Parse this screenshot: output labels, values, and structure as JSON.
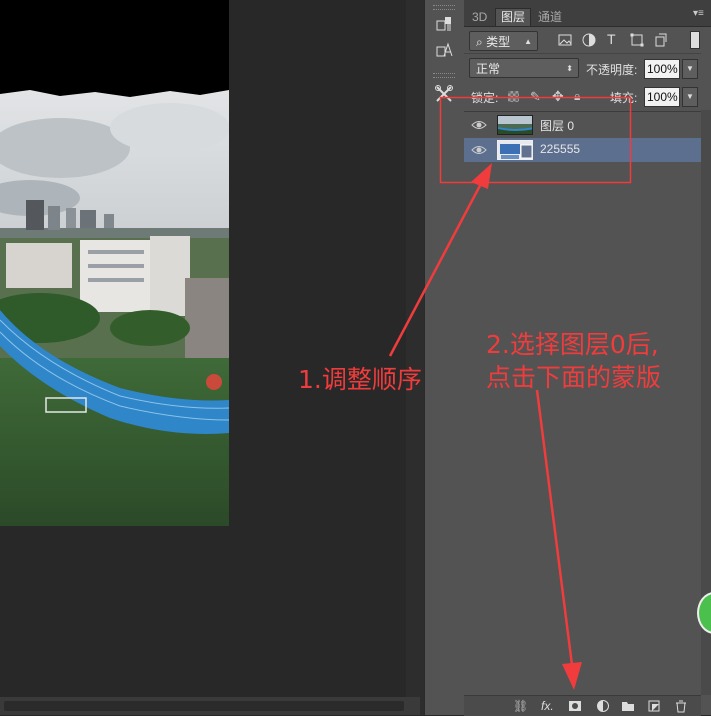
{
  "panel": {
    "tabs": [
      {
        "label": "3D"
      },
      {
        "label": "图层"
      },
      {
        "label": "通道"
      }
    ],
    "filter": {
      "label": "类型"
    },
    "blend_mode": {
      "value": "正常"
    },
    "opacity": {
      "label": "不透明度:",
      "value": "100%"
    },
    "lock": {
      "label": "锁定:"
    },
    "fill": {
      "label": "填充:",
      "value": "100%"
    },
    "layers": [
      {
        "name": "图层 0",
        "visible": true,
        "selected": false
      },
      {
        "name": "225555",
        "visible": true,
        "selected": true
      }
    ],
    "bottom_icons": [
      "link-icon",
      "fx-icon",
      "mask-icon",
      "adjustment-icon",
      "folder-icon",
      "new-layer-icon",
      "trash-icon"
    ],
    "fx_label": "fx."
  },
  "annotations": {
    "step1": "1.调整顺序",
    "step2_line1": "2.选择图层0后,",
    "step2_line2": "点击下面的蒙版"
  },
  "colors": {
    "annotation": "#f03c3c",
    "panel_bg": "#535353",
    "selected_row": "#5d6f8f"
  }
}
